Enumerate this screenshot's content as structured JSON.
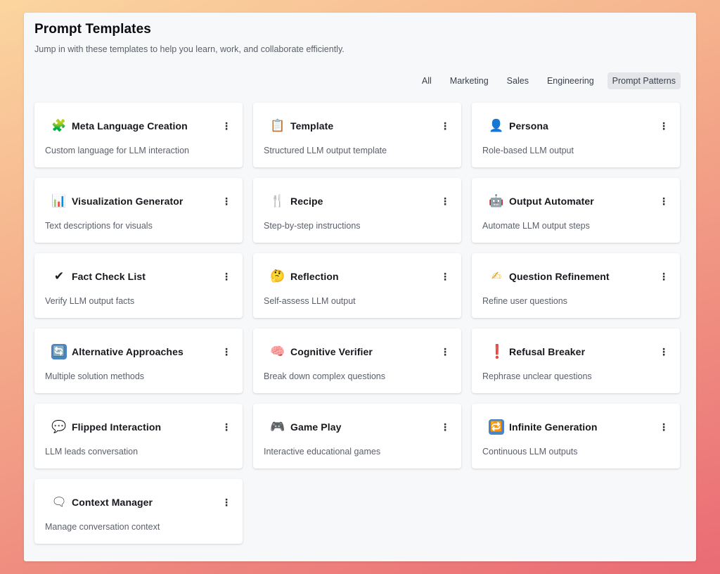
{
  "header": {
    "title": "Prompt Templates",
    "subtitle": "Jump in with these templates to help you learn, work, and collaborate efficiently."
  },
  "tabs": [
    {
      "label": "All",
      "active": false
    },
    {
      "label": "Marketing",
      "active": false
    },
    {
      "label": "Sales",
      "active": false
    },
    {
      "label": "Engineering",
      "active": false
    },
    {
      "label": "Prompt Patterns",
      "active": true
    }
  ],
  "menu_glyph": "⋮",
  "cards": [
    {
      "icon": "puzzle-icon",
      "glyph": "🧩",
      "title": "Meta Language Creation",
      "description": "Custom language for LLM interaction"
    },
    {
      "icon": "clipboard-icon",
      "glyph": "📋",
      "title": "Template",
      "description": "Structured LLM output template"
    },
    {
      "icon": "person-icon",
      "glyph": "👤",
      "title": "Persona",
      "description": "Role-based LLM output"
    },
    {
      "icon": "bar-chart-icon",
      "glyph": "📊",
      "title": "Visualization Generator",
      "description": "Text descriptions for visuals"
    },
    {
      "icon": "fork-knife-icon",
      "glyph": "🍴",
      "title": "Recipe",
      "description": "Step-by-step instructions"
    },
    {
      "icon": "robot-icon",
      "glyph": "🤖",
      "title": "Output Automater",
      "description": "Automate LLM output steps"
    },
    {
      "icon": "check-mark-icon",
      "glyph": "✔",
      "title": "Fact Check List",
      "description": "Verify LLM output facts"
    },
    {
      "icon": "thinking-face-icon",
      "glyph": "🤔",
      "title": "Reflection",
      "description": "Self-assess LLM output"
    },
    {
      "icon": "writing-hand-icon",
      "glyph": "✍",
      "title": "Question Refinement",
      "description": "Refine user questions"
    },
    {
      "icon": "cycle-arrows-icon",
      "glyph": "🔄",
      "title": "Alternative Approaches",
      "description": "Multiple solution methods"
    },
    {
      "icon": "brain-icon",
      "glyph": "🧠",
      "title": "Cognitive Verifier",
      "description": "Break down complex questions"
    },
    {
      "icon": "exclamation-icon",
      "glyph": "❗",
      "title": "Refusal Breaker",
      "description": "Rephrase unclear questions"
    },
    {
      "icon": "speech-bubble-icon",
      "glyph": "💬",
      "title": "Flipped Interaction",
      "description": "LLM leads conversation"
    },
    {
      "icon": "game-controller-icon",
      "glyph": "🎮",
      "title": "Game Play",
      "description": "Interactive educational games"
    },
    {
      "icon": "repeat-icon",
      "glyph": "🔁",
      "title": "Infinite Generation",
      "description": "Continuous LLM outputs"
    },
    {
      "icon": "speaking-bubble-icon",
      "glyph": "🗨",
      "title": "Context Manager",
      "description": "Manage conversation context"
    }
  ]
}
